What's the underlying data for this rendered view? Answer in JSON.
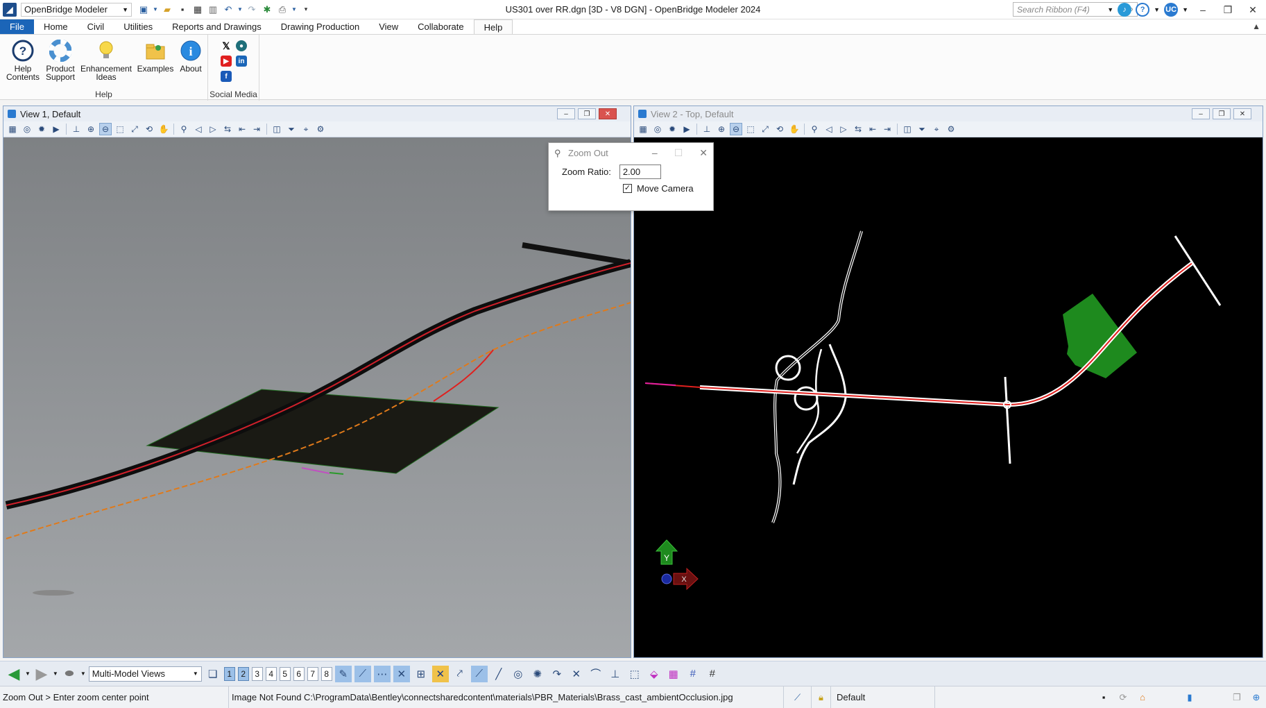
{
  "titlebar": {
    "workflow": "OpenBridge Modeler",
    "document_title": "US301 over RR.dgn [3D - V8 DGN] - OpenBridge Modeler 2024",
    "search_placeholder": "Search Ribbon (F4)",
    "user_initials": "UC"
  },
  "tabs": [
    "File",
    "Home",
    "Civil",
    "Utilities",
    "Reports and Drawings",
    "Drawing Production",
    "View",
    "Collaborate",
    "Help"
  ],
  "active_tab": "Help",
  "ribbon": {
    "help_group": {
      "label": "Help",
      "buttons": [
        {
          "line1": "Help",
          "line2": "Contents",
          "icon": "help-icon"
        },
        {
          "line1": "Product",
          "line2": "Support",
          "icon": "lifebuoy-icon"
        },
        {
          "line1": "Enhancement",
          "line2": "Ideas",
          "icon": "lightbulb-icon"
        },
        {
          "line1": "Examples",
          "line2": "",
          "icon": "folder-icon"
        },
        {
          "line1": "About",
          "line2": "",
          "icon": "info-icon"
        }
      ]
    },
    "social_group": {
      "label": "Social Media"
    }
  },
  "view1": {
    "title": "View 1, Default"
  },
  "view2": {
    "title": "View 2 - Top, Default"
  },
  "zoom_dialog": {
    "title": "Zoom Out",
    "ratio_label": "Zoom Ratio:",
    "ratio_value": "2.00",
    "move_camera_label": "Move Camera",
    "move_camera_checked": true
  },
  "bottombar": {
    "model_view": "Multi-Model Views",
    "view_numbers": [
      "1",
      "2",
      "3",
      "4",
      "5",
      "6",
      "7",
      "8"
    ],
    "active_views": [
      "1",
      "2"
    ]
  },
  "statusbar": {
    "prompt": "Zoom Out > Enter zoom center point",
    "message": "Image Not Found C:\\ProgramData\\Bentley\\connectsharedcontent\\materials\\PBR_Materials\\Brass_cast_ambientOcclusion.jpg",
    "level": "Default"
  },
  "colors": {
    "file_tab": "#1b65b8",
    "view1_bg": "#8d9092",
    "view2_bg": "#000000",
    "alignment": "#e0201e",
    "terrain": "#1e8a1e",
    "proposed": "#e07a1a"
  }
}
